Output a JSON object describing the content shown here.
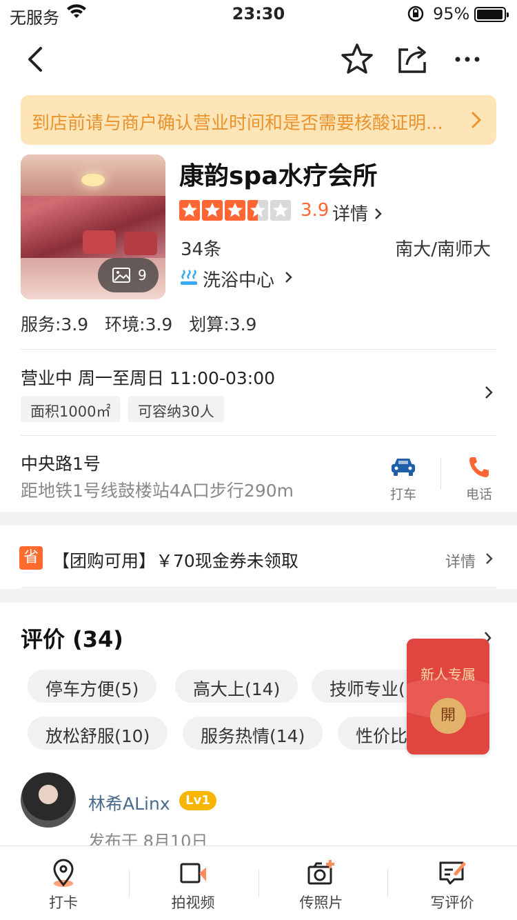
{
  "status_bar": {
    "carrier": "无服务",
    "time": "23:30",
    "battery": "95%"
  },
  "notice": {
    "text": "到店前请与商户确认营业时间和是否需要核酸证明..."
  },
  "shop": {
    "name": "康韵spa水疗会所",
    "photo_count": "9",
    "rating_value": 3.5,
    "rating": "3.9",
    "detail_label": "详情",
    "review_count": "34条",
    "area": "南大/南师大",
    "category": "洗浴中心",
    "scores": [
      "服务:3.9",
      "环境:3.9",
      "划算:3.9"
    ]
  },
  "hours": {
    "text": "营业中  周一至周日 11:00-03:00",
    "tags": [
      "面积1000㎡",
      "可容纳30人"
    ]
  },
  "address": {
    "line1": "中央路1号",
    "line2": "距地铁1号线鼓楼站4A口步行290m",
    "taxi_label": "打车",
    "phone_label": "电话"
  },
  "coupon": {
    "icon_char": "省",
    "text": "【团购可用】￥70现金券未领取",
    "detail": "详情"
  },
  "reviews": {
    "title": "评价 (34)",
    "tags_row1": [
      "停车方便(5)",
      "高大上(14)",
      "技师专业("
    ],
    "tags_row2": [
      "放松舒服(10)",
      "服务热情(14)",
      "性价比"
    ]
  },
  "red_packet": {
    "label": "新人专属",
    "open": "開"
  },
  "review_item": {
    "user": "林希ALinx",
    "level": "Lv1",
    "time": "发布于 8月10日"
  },
  "bottom_tabs": [
    "打卡",
    "拍视频",
    "传照片",
    "写评价"
  ],
  "colors": {
    "accent": "#ff6633",
    "notice_bg": "#fde5b8",
    "notice_text": "#e8932e",
    "taxi": "#1f5ea8"
  }
}
